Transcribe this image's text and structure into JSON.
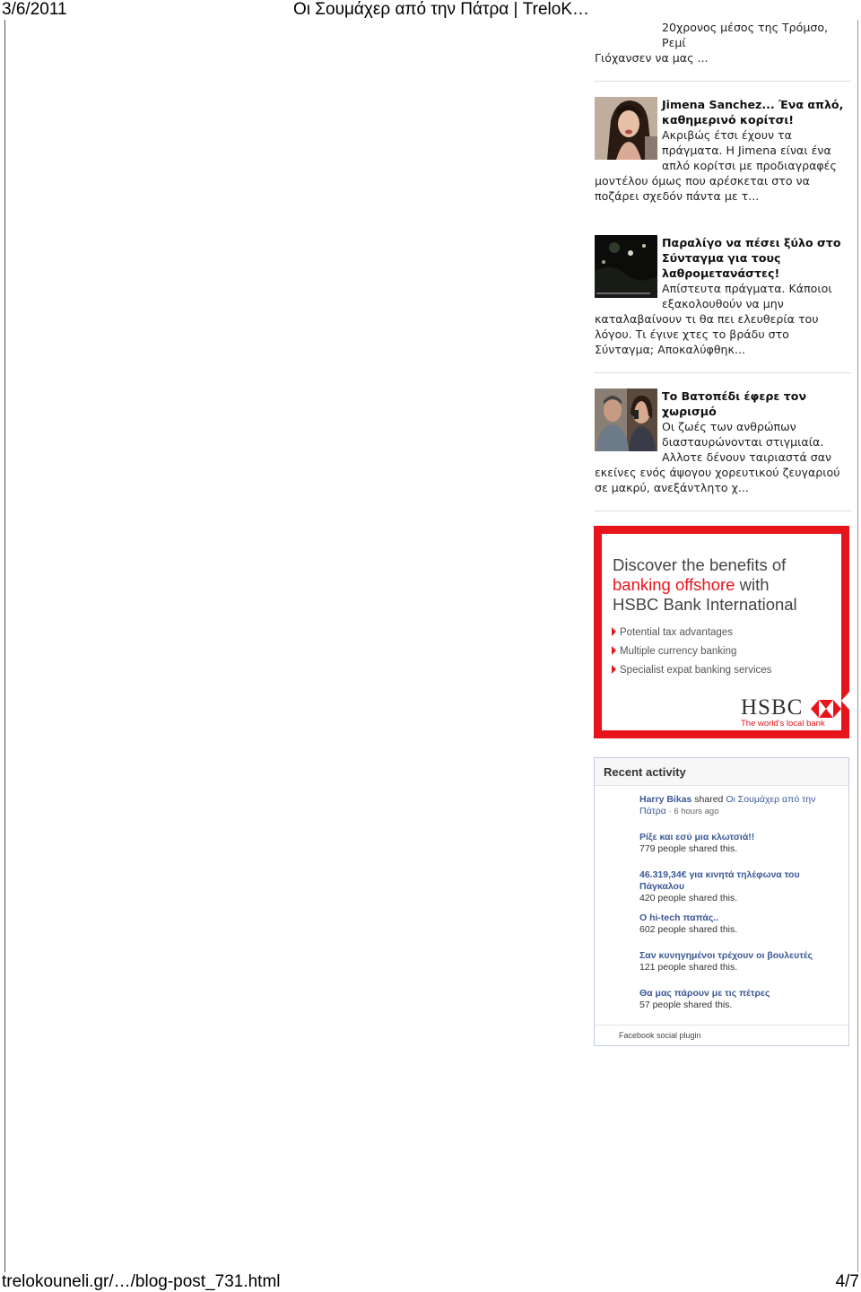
{
  "print_header": {
    "date": "3/6/2011",
    "title": "Οι Σουμάχερ από την Πάτρα | TreloK…"
  },
  "print_footer": {
    "url": "trelokouneli.gr/…/blog-post_731.html",
    "page": "4/7"
  },
  "posts": {
    "fragment": {
      "line1": "20χρονος μέσος της Τρόμσο, Ρεμί",
      "line2": "Γιόχανσεν να μας ..."
    },
    "items": [
      {
        "title": "Jimena Sanchez... Ένα απλό, καθημερινό κορίτσι!",
        "excerpt": "Ακριβώς έτσι έχουν τα πράγματα. Η Jimena είναι ένα απλό κορίτσι με προδιαγραφές μοντέλου όμως που αρέσκεται στο να ποζάρει σχεδόν πάντα με τ..."
      },
      {
        "title": "Παραλίγο να πέσει ξύλο στο Σύνταγμα για τους λαθρομετανάστες!",
        "excerpt": "Απίστευτα πράγματα. Κάποιοι εξακολουθούν να μην καταλαβαίνουν τι θα πει ελευθερία του λόγου. Τι έγινε χτες το βράδυ στο Σύνταγμα; Αποκαλύφθηκ..."
      },
      {
        "title": "Το Βατοπέδι έφερε τον χωρισμό",
        "excerpt": "Οι ζωές των ανθρώπων διασταυρώνονται στιγμιαία. Αλλοτε δένουν ταιριαστά σαν εκείνες ενός άψογου χορευτικού ζευγαριού σε μακρύ, ανεξάντλητο χ..."
      }
    ]
  },
  "ad": {
    "headline_1": "Discover the benefits of",
    "headline_2_red": "banking offshore",
    "headline_2_rest": " with",
    "headline_3": "HSBC Bank International",
    "bullets": [
      "Potential tax advantages",
      "Multiple currency banking",
      "Specialist expat banking services"
    ],
    "logo": "HSBC",
    "tagline": "The world's local bank",
    "colors": {
      "brand_red": "#e8141b"
    }
  },
  "facebook": {
    "heading": "Recent activity",
    "first": {
      "user": "Harry Bikas",
      "verb": " shared ",
      "link": "Οι Σουμάχερ από την Πάτρα",
      "sep": " · ",
      "time": "6 hours ago"
    },
    "items": [
      {
        "title": "Ρίξε και εσύ μια κλωτσιά!!",
        "count": "779 people shared this."
      },
      {
        "title": "46.319,34€ για κινητά τηλέφωνα του Πάγκαλου",
        "count": "420 people shared this."
      },
      {
        "title": "Ο hi-tech παπάς..",
        "count": "602 people shared this."
      },
      {
        "title": "Σαν κυνηγημένοι τρέχουν οι βουλευτές",
        "count": "121 people shared this."
      },
      {
        "title": "Θα μας πάρουν με τις πέτρες",
        "count": "57 people shared this."
      }
    ],
    "footer": "Facebook social plugin",
    "colors": {
      "link": "#3b5998"
    }
  }
}
